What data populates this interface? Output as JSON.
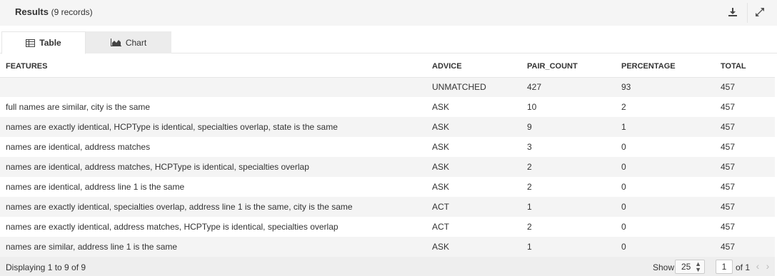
{
  "header": {
    "title": "Results",
    "record_count": "(9 records)",
    "download_icon": "download-icon",
    "expand_icon": "expand-icon"
  },
  "tabs": [
    {
      "label": "Table",
      "icon": "table-icon",
      "active": true
    },
    {
      "label": "Chart",
      "icon": "area-chart-icon",
      "active": false
    }
  ],
  "table": {
    "columns": [
      "FEATURES",
      "ADVICE",
      "PAIR_COUNT",
      "PERCENTAGE",
      "TOTAL"
    ],
    "rows": [
      [
        "",
        "UNMATCHED",
        "427",
        "93",
        "457"
      ],
      [
        "full names are similar, city is the same",
        "ASK",
        "10",
        "2",
        "457"
      ],
      [
        "names are exactly identical, HCPType is identical, specialties overlap, state is the same",
        "ASK",
        "9",
        "1",
        "457"
      ],
      [
        "names are identical, address matches",
        "ASK",
        "3",
        "0",
        "457"
      ],
      [
        "names are identical, address matches, HCPType is identical, specialties overlap",
        "ASK",
        "2",
        "0",
        "457"
      ],
      [
        "names are identical, address line 1 is the same",
        "ASK",
        "2",
        "0",
        "457"
      ],
      [
        "names are exactly identical, specialties overlap, address line 1 is the same, city is the same",
        "ACT",
        "1",
        "0",
        "457"
      ],
      [
        "names are exactly identical, address matches, HCPType is identical, specialties overlap",
        "ACT",
        "2",
        "0",
        "457"
      ],
      [
        "names are similar, address line 1 is the same",
        "ASK",
        "1",
        "0",
        "457"
      ]
    ]
  },
  "footer": {
    "displaying": "Displaying 1 to 9 of 9",
    "show_label": "Show",
    "page_size": "25",
    "page_number": "1",
    "of_label": "of 1"
  }
}
